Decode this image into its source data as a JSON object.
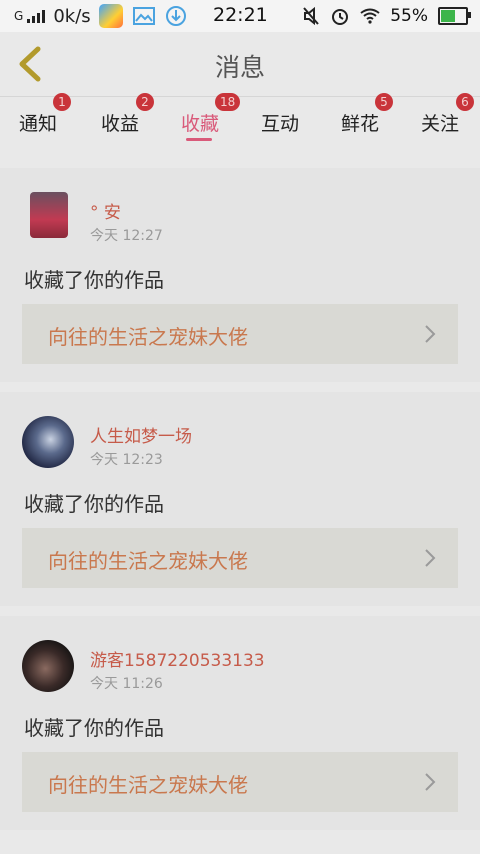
{
  "status_bar": {
    "network": "G",
    "rate": "0k/s",
    "time": "22:21",
    "battery": "55%",
    "battery_level": 0.55,
    "icons": [
      "signal-icon",
      "app-icon",
      "gallery-icon",
      "download-icon",
      "mute-icon",
      "alarm-icon",
      "wifi-icon",
      "battery-icon"
    ]
  },
  "header": {
    "title": "消息",
    "back_icon": "chevron-left-icon"
  },
  "tabs": [
    {
      "label": "通知",
      "badge": "1"
    },
    {
      "label": "收益",
      "badge": "2"
    },
    {
      "label": "收藏",
      "badge": "18",
      "active": true
    },
    {
      "label": "互动",
      "badge": ""
    },
    {
      "label": "鲜花",
      "badge": "5"
    },
    {
      "label": "关注",
      "badge": "6"
    }
  ],
  "colors": {
    "accent": "#d95a7a",
    "badge": "#c9343a",
    "username": "#c65b4a",
    "work_title": "#c9784e"
  },
  "items": [
    {
      "user": "°  安",
      "time": "今天 12:27",
      "action": "收藏了你的作品",
      "work": "向往的生活之宠妹大佬"
    },
    {
      "user": "人生如梦一场",
      "time": "今天 12:23",
      "action": "收藏了你的作品",
      "work": "向往的生活之宠妹大佬"
    },
    {
      "user": "游客1587220533133",
      "time": "今天 11:26",
      "action": "收藏了你的作品",
      "work": "向往的生活之宠妹大佬"
    }
  ]
}
